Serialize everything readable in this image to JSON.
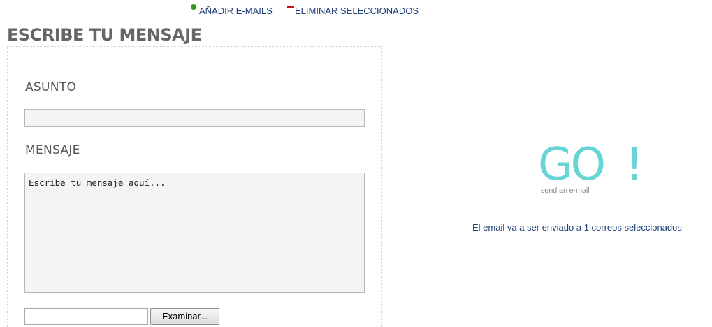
{
  "top_links": {
    "add_emails": "AÑADIR E-MAILS",
    "remove_selected": "ELIMINAR SELECCIONADOS"
  },
  "page_title": "ESCRIBE TU MENSAJE",
  "form": {
    "subject_label": "ASUNTO",
    "subject_value": "",
    "message_label": "MENSAJE",
    "message_value": "Escribe tu mensaje aquí...",
    "file_value": "",
    "browse_label": "Examinar..."
  },
  "send": {
    "logo_text": "GO",
    "logo_exclamation": "!",
    "logo_subtitle": "send an e-mail",
    "status_text": "El email va a ser enviado a 1 correos seleccionados"
  },
  "colors": {
    "link": "#1f3f78",
    "add_icon": "#2e9a1c",
    "remove_icon": "#c4121a",
    "go_accent": "#69d4d6",
    "title": "#666666"
  },
  "icons": {
    "add": "green-dot-icon",
    "remove": "red-minus-icon"
  }
}
